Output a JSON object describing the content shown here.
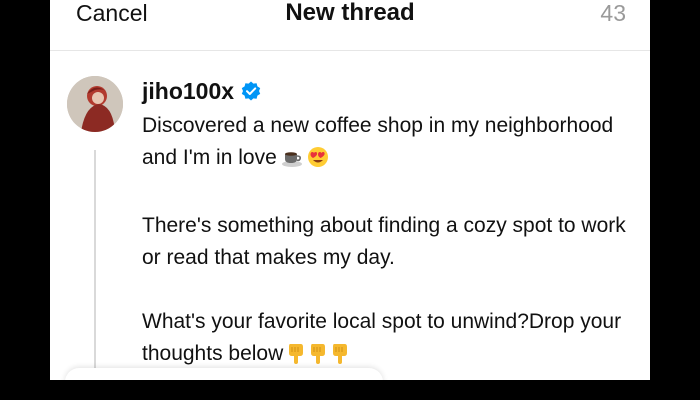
{
  "header": {
    "cancel_label": "Cancel",
    "title": "New thread",
    "char_count": "43"
  },
  "post": {
    "username": "jiho100x",
    "verified": true,
    "paragraph1": "Discovered a new coffee shop in my neighborhood and I'm in love",
    "paragraph2": "There's something about finding a cozy spot to work or read that makes my day.",
    "paragraph3": "What's your favorite local spot to unwind?Drop your thoughts below",
    "emojis_p1": [
      "coffee-cup-icon",
      "heart-eyes-icon"
    ],
    "emojis_p3": [
      "pointing-down-icon",
      "pointing-down-icon",
      "pointing-down-icon"
    ]
  },
  "colors": {
    "verified_blue": "#0095f6",
    "counter_gray": "#9a9a9a",
    "background_frame": "#000000"
  }
}
